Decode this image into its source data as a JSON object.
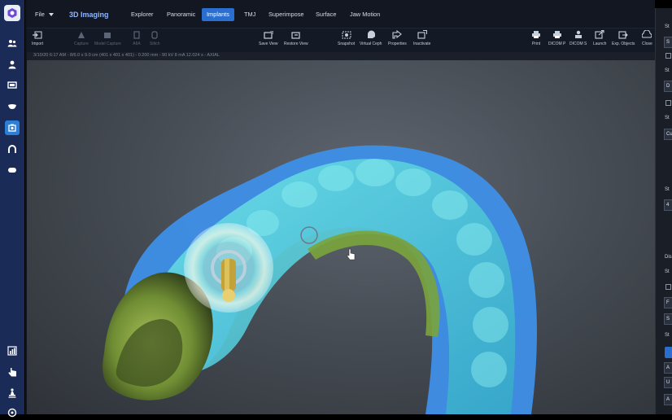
{
  "menubar": {
    "file_label": "File",
    "app_title": "3D Imaging",
    "tabs": [
      {
        "label": "Explorer",
        "active": false
      },
      {
        "label": "Panoramic",
        "active": false
      },
      {
        "label": "Implants",
        "active": true
      },
      {
        "label": "TMJ",
        "active": false
      },
      {
        "label": "Superimpose",
        "active": false
      },
      {
        "label": "Surface",
        "active": false
      },
      {
        "label": "Jaw Motion",
        "active": false
      }
    ]
  },
  "toolbar": {
    "tools": [
      {
        "label": "Import",
        "icon": "import-icon",
        "enabled": true
      },
      {
        "label": "Capture",
        "icon": "capture-icon",
        "enabled": false
      },
      {
        "label": "Model Capture",
        "icon": "model-capture-icon",
        "enabled": false
      },
      {
        "label": "AIIA",
        "icon": "aiia-icon",
        "enabled": false
      },
      {
        "label": "Stitch",
        "icon": "stitch-icon",
        "enabled": false
      },
      {
        "label": "Save View",
        "icon": "save-view-icon",
        "enabled": true
      },
      {
        "label": "Restore View",
        "icon": "restore-view-icon",
        "enabled": true
      },
      {
        "label": "Snapshot",
        "icon": "snapshot-icon",
        "enabled": true
      },
      {
        "label": "Virtual Ceph",
        "icon": "virtual-ceph-icon",
        "enabled": true
      },
      {
        "label": "Properties",
        "icon": "properties-icon",
        "enabled": true
      },
      {
        "label": "Inactivate",
        "icon": "inactivate-icon",
        "enabled": true
      },
      {
        "label": "Print",
        "icon": "print-icon",
        "enabled": true
      },
      {
        "label": "DICOM P",
        "icon": "dicom-print-icon",
        "enabled": true
      },
      {
        "label": "DICOM S",
        "icon": "dicom-send-icon",
        "enabled": true
      },
      {
        "label": "Launch",
        "icon": "launch-icon",
        "enabled": true
      },
      {
        "label": "Exp. Objects",
        "icon": "export-objects-icon",
        "enabled": true
      },
      {
        "label": "Close",
        "icon": "close-icon",
        "enabled": true
      }
    ]
  },
  "viewport": {
    "info_text": "3/10/20 6:17 AM - 8/6.0 x 9.0 cm (401 x 401 x 401) - 0.200 mm - 90 kV 8 mA 12.024 s - AXIAL"
  },
  "right_panel": {
    "labels": [
      "St",
      "St",
      "St",
      "St",
      "Dis",
      "St",
      "St"
    ],
    "boxes": [
      "S",
      "D",
      "Cu",
      "4",
      "F",
      "S",
      "A",
      "U",
      "A"
    ]
  },
  "colors": {
    "accent": "#2a6fd0",
    "rail": "#1b2b57",
    "menubar": "#121722",
    "viewport_bg": "#50565e",
    "scan_blue": "#3d8fe6",
    "teeth_cyan": "#4fd0dd",
    "gum_green": "#7ea33a"
  },
  "left_rail": {
    "icons": [
      "app-logo-icon",
      "patients-icon",
      "person-icon",
      "monitor-icon",
      "tooth-icon",
      "3d-imaging-icon",
      "jaw-arch-icon",
      "teeth-icon",
      "chart-icon",
      "hand-pointer-icon",
      "person-walk-icon",
      "settings-icon"
    ]
  }
}
